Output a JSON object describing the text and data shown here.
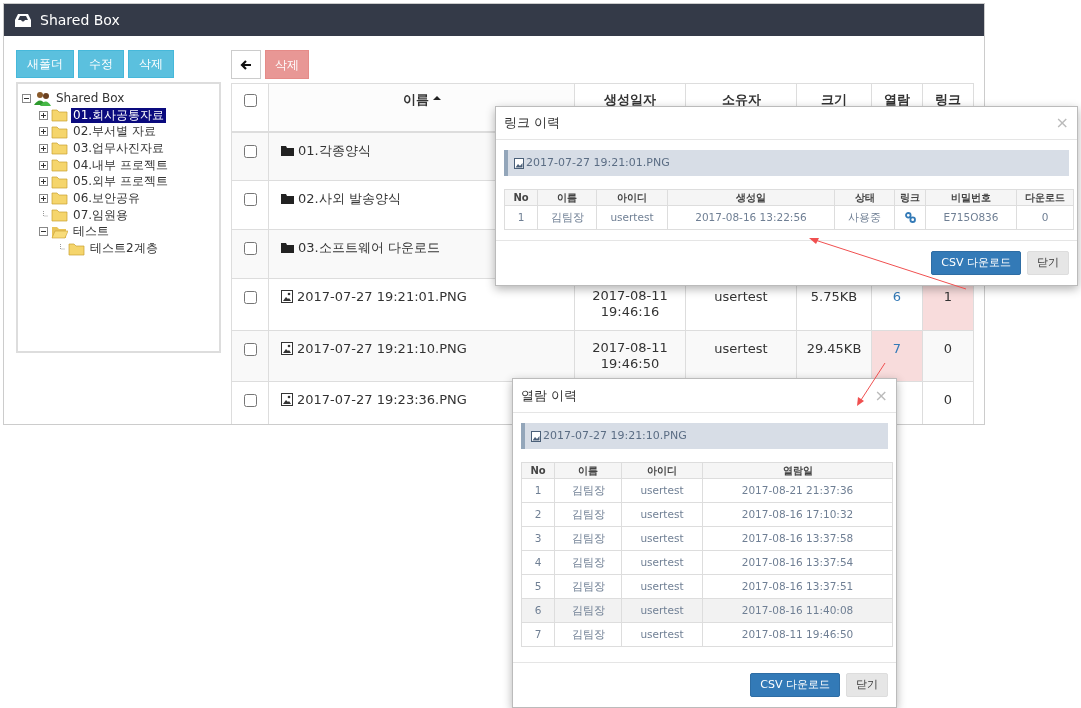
{
  "window": {
    "title": "Shared Box"
  },
  "left_toolbar": {
    "buttons": [
      {
        "label": "새폴더"
      },
      {
        "label": "수정"
      },
      {
        "label": "삭제"
      }
    ]
  },
  "tree": [
    {
      "label": "Shared Box",
      "kind": "root",
      "expanded": true,
      "selected": false,
      "children": [
        {
          "label": "01.회사공통자료",
          "kind": "folder",
          "expanded": false,
          "selected": true
        },
        {
          "label": "02.부서별 자료",
          "kind": "folder",
          "expanded": false,
          "selected": false
        },
        {
          "label": "03.업무사진자료",
          "kind": "folder",
          "expanded": false,
          "selected": false
        },
        {
          "label": "04.내부 프로젝트",
          "kind": "folder",
          "expanded": false,
          "selected": false
        },
        {
          "label": "05.외부 프로젝트",
          "kind": "folder",
          "expanded": false,
          "selected": false
        },
        {
          "label": "06.보안공유",
          "kind": "folder",
          "expanded": false,
          "selected": false
        },
        {
          "label": "07.임원용",
          "kind": "folder",
          "selected": false
        },
        {
          "label": "테스트",
          "kind": "folder",
          "expanded": true,
          "selected": false,
          "children": [
            {
              "label": "테스트2계층",
              "kind": "folder",
              "selected": false
            }
          ]
        }
      ]
    }
  ],
  "right_toolbar": {
    "delete_button": {
      "label": "삭제",
      "disabled": true
    }
  },
  "table": {
    "header_checkbox": {
      "checked": false
    },
    "columns": [
      {
        "label": "이름",
        "sorted": true
      },
      {
        "label": "생성일자",
        "sorted": false
      },
      {
        "label": "소유자",
        "sorted": false
      },
      {
        "label": "크기",
        "sorted": false
      },
      {
        "label": "열람",
        "sorted": false
      },
      {
        "label": "링크",
        "sorted": false
      }
    ],
    "rows": [
      {
        "kind": "folder",
        "checked": false,
        "name": "01.각종양식"
      },
      {
        "kind": "folder",
        "checked": false,
        "name": "02.사외 발송양식"
      },
      {
        "kind": "folder",
        "checked": false,
        "name": "03.소프트웨어 다운로드"
      },
      {
        "kind": "file",
        "checked": false,
        "name": "2017-07-27 19:21:01.PNG",
        "created": "2017-08-11 19:46:16",
        "owner": "usertest",
        "size": "5.75KB",
        "views": {
          "text": "6",
          "highlighted": false
        },
        "links": {
          "text": "1",
          "highlighted": true
        }
      },
      {
        "kind": "file",
        "checked": false,
        "name": "2017-07-27 19:21:10.PNG",
        "created": "2017-08-11 19:46:50",
        "owner": "usertest",
        "size": "29.45KB",
        "views": {
          "text": "7",
          "highlighted": true
        },
        "links": {
          "text": "0",
          "highlighted": false
        }
      },
      {
        "kind": "file",
        "checked": false,
        "name": "2017-07-27 19:23:36.PNG",
        "links": {
          "text": "0",
          "highlighted": false
        }
      }
    ]
  },
  "link_dialog": {
    "title": "링크 이력",
    "close": "×",
    "file": "2017-07-27 19:21:01.PNG",
    "columns": [
      "No",
      "이름",
      "아이디",
      "생성일",
      "상태",
      "링크",
      "비밀번호",
      "다운로드"
    ],
    "rows": [
      {
        "no": "1",
        "name": "김팀장",
        "id": "usertest",
        "created": "2017-08-16 13:22:56",
        "status": "사용중",
        "password": "E715O836",
        "downloads": "0"
      }
    ],
    "buttons": [
      {
        "label": "CSV 다운로드",
        "kind": "primary"
      },
      {
        "label": "닫기",
        "kind": "default"
      }
    ]
  },
  "view_dialog": {
    "title": "열람 이력",
    "close": "×",
    "file": "2017-07-27 19:21:10.PNG",
    "columns": [
      "No",
      "이름",
      "아이디",
      "열람일"
    ],
    "rows": [
      {
        "no": "1",
        "name": "김팀장",
        "id": "usertest",
        "viewed": "2017-08-21 21:37:36",
        "hovered": false
      },
      {
        "no": "2",
        "name": "김팀장",
        "id": "usertest",
        "viewed": "2017-08-16 17:10:32",
        "hovered": false
      },
      {
        "no": "3",
        "name": "김팀장",
        "id": "usertest",
        "viewed": "2017-08-16 13:37:58",
        "hovered": false
      },
      {
        "no": "4",
        "name": "김팀장",
        "id": "usertest",
        "viewed": "2017-08-16 13:37:54",
        "hovered": false
      },
      {
        "no": "5",
        "name": "김팀장",
        "id": "usertest",
        "viewed": "2017-08-16 13:37:51",
        "hovered": false
      },
      {
        "no": "6",
        "name": "김팀장",
        "id": "usertest",
        "viewed": "2017-08-16 11:40:08",
        "hovered": true
      },
      {
        "no": "7",
        "name": "김팀장",
        "id": "usertest",
        "viewed": "2017-08-11 19:46:50",
        "hovered": false
      }
    ],
    "buttons": [
      {
        "label": "CSV 다운로드",
        "kind": "primary"
      },
      {
        "label": "닫기",
        "kind": "default"
      }
    ]
  }
}
